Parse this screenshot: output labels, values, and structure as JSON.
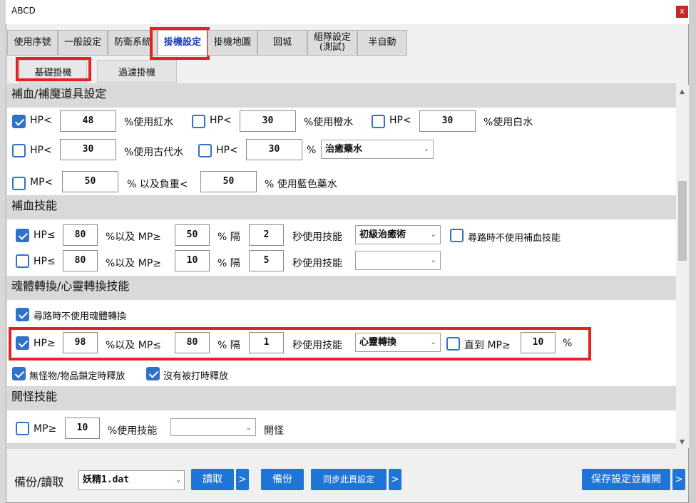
{
  "window": {
    "title": "ABCD",
    "close": "x"
  },
  "tabs": [
    {
      "label": "使用序號"
    },
    {
      "label": "一般設定"
    },
    {
      "label": "防衛系統"
    },
    {
      "label": "掛機設定"
    },
    {
      "label": "掛機地圖"
    },
    {
      "label": "回城"
    },
    {
      "label": "組隊設定\n(測試)"
    },
    {
      "label": "半自動"
    }
  ],
  "subtabs": [
    {
      "label": "基礎掛機"
    },
    {
      "label": "過濾掛機"
    }
  ],
  "potions": {
    "title": "補血/補魔道具設定",
    "row1": [
      {
        "checked": true,
        "label": "HP<",
        "value": "48",
        "suffix": "%使用紅水"
      },
      {
        "checked": false,
        "label": "HP<",
        "value": "30",
        "suffix": "%使用橙水"
      },
      {
        "checked": false,
        "label": "HP<",
        "value": "30",
        "suffix": "%使用白水"
      }
    ],
    "row2": [
      {
        "checked": false,
        "label": "HP<",
        "value": "30",
        "suffix": "%使用古代水"
      },
      {
        "checked": false,
        "label": "HP<",
        "value": "30",
        "suffix": "%",
        "select": "治癒藥水"
      }
    ],
    "row3": {
      "checked": false,
      "label": "MP<",
      "value": "50",
      "mid": "% 以及負重<",
      "value2": "50",
      "suffix": "% 使用藍色藥水"
    }
  },
  "heal": {
    "title": "補血技能",
    "rows": [
      {
        "checked": true,
        "hp_label": "HP≤",
        "hp": "80",
        "mp_label": "%以及 MP≥",
        "mp": "50",
        "gap_label": "% 隔",
        "gap": "2",
        "skill_label": "秒使用技能",
        "skill": "初級治癒術"
      },
      {
        "checked": false,
        "hp_label": "HP≤",
        "hp": "80",
        "mp_label": "%以及 MP≥",
        "mp": "10",
        "gap_label": "% 隔",
        "gap": "5",
        "skill_label": "秒使用技能",
        "skill": ""
      }
    ],
    "extra": {
      "checked": false,
      "label": "尋路時不使用補血技能"
    }
  },
  "soul": {
    "title": "魂體轉換/心靈轉換技能",
    "walk": {
      "checked": true,
      "label": "尋路時不使用魂體轉換"
    },
    "row": {
      "checked": true,
      "hp_label": "HP≥",
      "hp": "98",
      "mp_label": "%以及 MP≤",
      "mp": "80",
      "gap_label": "% 隔",
      "gap": "1",
      "skill_label": "秒使用技能",
      "skill": "心靈轉換",
      "until_checked": false,
      "until_label": "直到 MP≥",
      "until": "10",
      "pct": "%"
    },
    "opt1": {
      "checked": true,
      "label": "無怪物/物品鎖定時釋放"
    },
    "opt2": {
      "checked": true,
      "label": "沒有被打時釋放"
    }
  },
  "open": {
    "title": "開怪技能",
    "row": {
      "checked": false,
      "label": "MP≥",
      "value": "10",
      "suffix": "%使用技能",
      "skill": "",
      "tail": "開怪"
    }
  },
  "footer": {
    "backup_label": "備份/讀取",
    "file": "妖精1.dat",
    "read": "讀取",
    "arrow": ">",
    "backup": "備份",
    "sync": "同步此頁設定",
    "save": "保存設定並離開"
  },
  "colors": {
    "accent": "#1f74d8",
    "highlight": "#e32222",
    "checkbox": "#2f73c8"
  }
}
